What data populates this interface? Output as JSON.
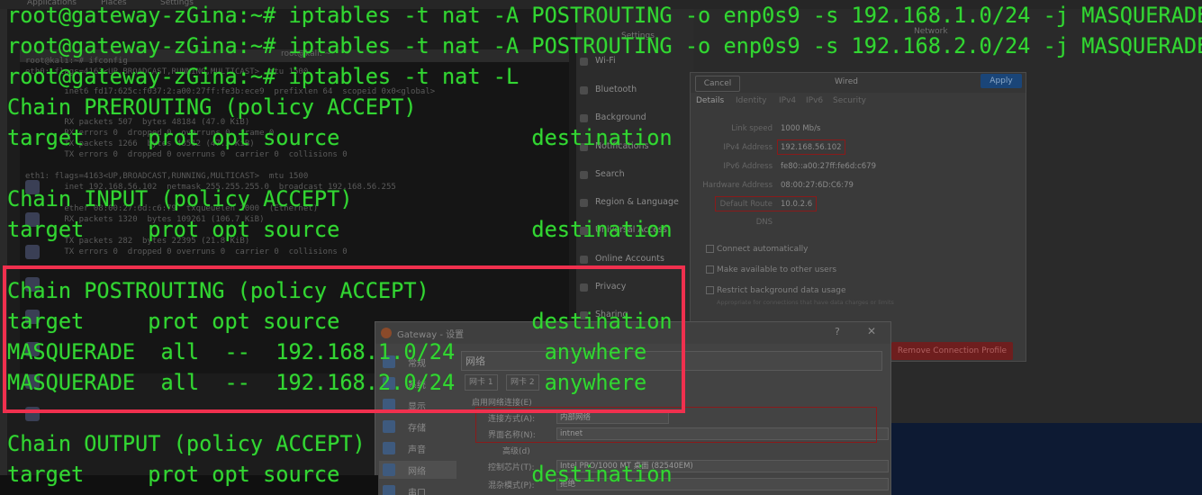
{
  "terminal": {
    "lines": [
      "root@gateway-zGina:~# iptables -t nat -A POSTROUTING -o enp0s9 -s 192.168.1.0/24 -j MASQUERADE",
      "root@gateway-zGina:~# iptables -t nat -A POSTROUTING -o enp0s9 -s 192.168.2.0/24 -j MASQUERADE",
      "root@gateway-zGina:~# iptables -t nat -L",
      "Chain PREROUTING (policy ACCEPT)",
      "target     prot opt source               destination",
      "",
      "Chain INPUT (policy ACCEPT)",
      "target     prot opt source               destination",
      "",
      "Chain POSTROUTING (policy ACCEPT)",
      "target     prot opt source               destination",
      "MASQUERADE  all  --  192.168.1.0/24       anywhere",
      "MASQUERADE  all  --  192.168.2.0/24       anywhere",
      "",
      "Chain OUTPUT (policy ACCEPT)",
      "target     prot opt source               destination"
    ],
    "text_color": "#33d633"
  },
  "highlight": {
    "color": "#f0304e"
  },
  "background": {
    "topbar": {
      "applications": "Applications",
      "places": "Places",
      "settings": "Settings"
    },
    "kali_terminal": {
      "title": "root@kali: ~",
      "lines": [
        "root@kali:~# ifconfig",
        "eth0: flags=4163<UP,BROADCAST,RUNNING,MULTICAST>  mtu 1500",
        "        inet6 fd17:625c:f037:2:a00:27ff:fe3b:ece9  prefixlen 64  scopeid 0x0<global>",
        "        RX packets 507  bytes 48184 (47.0 KiB)",
        "        RX errors 0  dropped 0  overruns 0  frame 0",
        "        TX packets 1266  bytes 48512 (47.3 KiB)",
        "        TX errors 0  dropped 0 overruns 0  carrier 0  collisions 0",
        "",
        "eth1: flags=4163<UP,BROADCAST,RUNNING,MULTICAST>  mtu 1500",
        "        inet 192.168.56.102  netmask 255.255.255.0  broadcast 192.168.56.255",
        "        ether 08:00:27:6d:c6:79  txqueuelen 1000  (Ethernet)",
        "        RX packets 1320  bytes 109261 (106.7 KiB)",
        "        TX packets 282  bytes 22395 (21.8 KiB)",
        "        TX errors 0  dropped 0 overruns 0  carrier 0  collisions 0"
      ]
    },
    "settings_sidebar": {
      "title": "Settings",
      "items": [
        "Wi-Fi",
        "Bluetooth",
        "Background",
        "Notifications",
        "Search",
        "Region & Language",
        "Universal Access",
        "Online Accounts",
        "Privacy",
        "Sharing"
      ]
    },
    "network_title": "Network",
    "wired_dialog": {
      "cancel": "Cancel",
      "title": "Wired",
      "apply": "Apply",
      "tabs": [
        "Details",
        "Identity",
        "IPv4",
        "IPv6",
        "Security"
      ],
      "rows": [
        {
          "key": "Link speed",
          "value": "1000 Mb/s"
        },
        {
          "key": "IPv4 Address",
          "value": "192.168.56.102"
        },
        {
          "key": "IPv6 Address",
          "value": "fe80::a00:27ff:fe6d:c679"
        },
        {
          "key": "Hardware Address",
          "value": "08:00:27:6D:C6:79"
        },
        {
          "key": "Default Route",
          "value": "10.0.2.6"
        },
        {
          "key": "DNS",
          "value": ""
        }
      ],
      "checks": [
        "Connect automatically",
        "Make available to other users",
        "Restrict background data usage"
      ],
      "note": "Appropriate for connections that have data charges or limits",
      "remove": "Remove Connection Profile"
    },
    "vbox_dialog": {
      "title": "Gateway - 设置",
      "sidebar": [
        "常规",
        "系统",
        "显示",
        "存储",
        "声音",
        "网络",
        "串口"
      ],
      "header": "网络",
      "tabs": [
        "网卡 1",
        "网卡 2"
      ],
      "enable": "启用网络连接(E)",
      "attach_label": "连接方式(A):",
      "attach_value": "内部网络",
      "name_label": "界面名称(N):",
      "name_value": "intnet",
      "advanced": "高级(d)",
      "adapter_label": "控制芯片(T):",
      "adapter_value": "Intel PRO/1000 MT 桌面 (82540EM)",
      "promisc_label": "混杂模式(P):",
      "promisc_value": "拒绝"
    }
  }
}
